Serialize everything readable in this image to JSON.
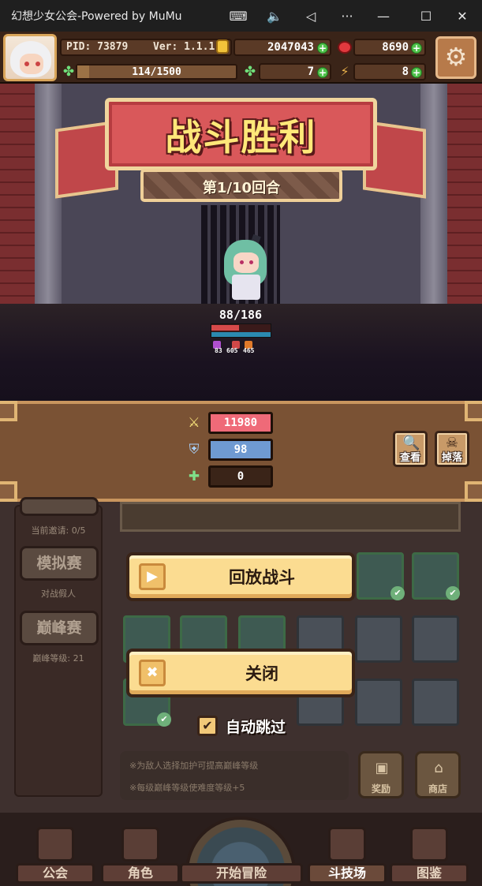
{
  "window": {
    "title": "幻想少女公会-Powered by MuMu",
    "buttons": [
      "keyboard-icon",
      "volume-icon",
      "back-icon",
      "more-icon",
      "minimize-icon",
      "maximize-icon",
      "close-icon"
    ],
    "glyphs": {
      "keyboard": "⌨",
      "volume": "🔈",
      "back": "◁",
      "more": "···",
      "minimize": "—",
      "maximize": "☐",
      "close": "✕"
    }
  },
  "hud": {
    "pid": "PID: 73879",
    "version": "Ver: 1.1.1.2",
    "gold": "2047043",
    "gems": "8690",
    "energy": "114/1500",
    "energy_fraction": 0.076,
    "clovers": "7",
    "tickets": "8",
    "plus": "+",
    "settings_glyph": "⚙"
  },
  "battle": {
    "title": "战斗胜利",
    "round": "第1/10回合",
    "hp": "88/186",
    "hp_fraction": 0.47,
    "buffs": [
      {
        "icon": "magic-buff-icon",
        "value": "83",
        "color": "#b050d0"
      },
      {
        "icon": "attack-buff-icon",
        "value": "605",
        "color": "#d04848"
      },
      {
        "icon": "fire-buff-icon",
        "value": "465",
        "color": "#e07a2a"
      }
    ]
  },
  "stats": {
    "damage": "11980",
    "shield": "98",
    "heal": "0",
    "colors": {
      "damage": "#ef6a78",
      "shield": "#6f9ad2",
      "heal": "#3a2418"
    },
    "view_label": "查看",
    "drops_label": "掉落",
    "glyphs": {
      "damage": "⚔",
      "shield": "⛨",
      "heal": "✚",
      "view": "🔍",
      "drops": "☠"
    }
  },
  "arena": {
    "invite_count": "当前邀请: 0/5",
    "mock_label": "模拟赛",
    "mock_sub": "对战假人",
    "peak_label": "巅峰赛",
    "peak_level": "巅峰等级: 21",
    "note1": "※为敌人选择加护可提高巅峰等级",
    "note2": "※每级巅峰等级使难度等级+5",
    "rewards_label": "奖励",
    "shop_label": "商店",
    "check_glyph": "✔",
    "chest_glyph": "▣",
    "shop_glyph": "⌂"
  },
  "dialog": {
    "replay_label": "回放战斗",
    "close_label": "关闭",
    "auto_skip_label": "自动跳过",
    "auto_skip_checked": true,
    "replay_glyph": "▶",
    "close_glyph": "✖",
    "check_glyph": "✔"
  },
  "nav": {
    "items": [
      {
        "label": "公会"
      },
      {
        "label": "角色"
      },
      {
        "label": "开始冒险"
      },
      {
        "label": "斗技场"
      },
      {
        "label": "图鉴"
      }
    ],
    "active": "斗技场"
  }
}
